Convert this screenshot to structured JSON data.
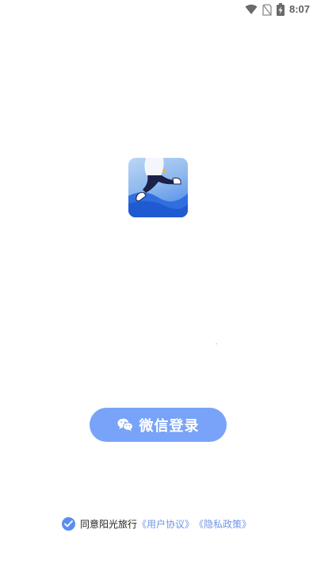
{
  "status_bar": {
    "time": "8:07",
    "icons": [
      "wifi-icon",
      "no-sim-icon",
      "battery-charging-icon"
    ]
  },
  "app_icon": {
    "name": "app-logo-runner"
  },
  "login": {
    "wechat_button_label": "微信登录",
    "wechat_icon": "wechat-icon"
  },
  "agreement": {
    "checked": true,
    "prefix": "同意阳光旅行",
    "user_agreement_link": "《用户协议》",
    "privacy_policy_link": "《隐私政策》"
  },
  "colors": {
    "primary_button": "#78a3f8",
    "checkbox": "#5b8def",
    "link": "#6f97e6"
  }
}
